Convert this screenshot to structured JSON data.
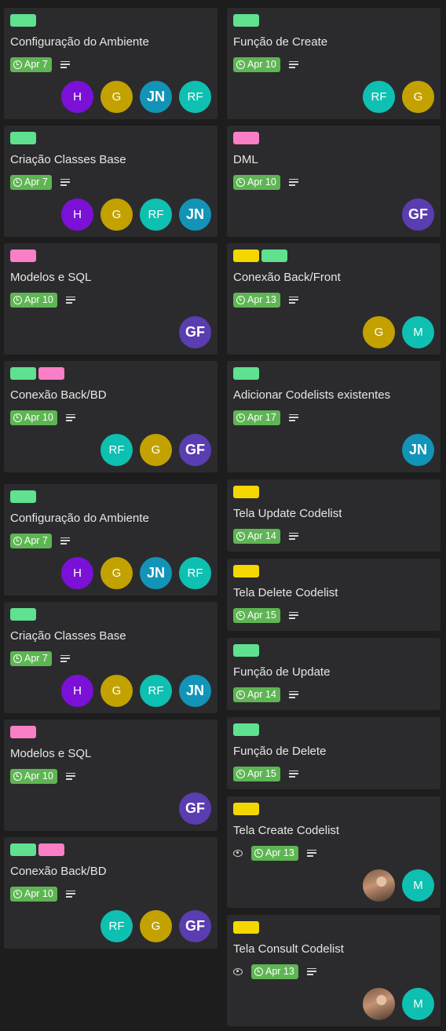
{
  "colors": {
    "green": "#5fe18f",
    "pink": "#fa7fc7",
    "yellow": "#f4d700",
    "due_badge": "#5eb553",
    "card_bg": "#2b2b2d",
    "board_bg": "#1d1d1e"
  },
  "members": {
    "H": {
      "initials": "H",
      "color": "#7b10d6"
    },
    "G": {
      "initials": "G",
      "color": "#c3a200"
    },
    "JN": {
      "initials": "JN",
      "color": "#1294b8"
    },
    "RF": {
      "initials": "RF",
      "color": "#0ec0b1"
    },
    "GF": {
      "initials": "GF",
      "color": "#5a3db0"
    },
    "M": {
      "initials": "M",
      "color": "#0ec0b1"
    }
  },
  "left_column": {
    "cards": [
      {
        "title": "Configuração do Ambiente",
        "labels": [
          "green"
        ],
        "due": "Apr 7",
        "has_description": true,
        "members": [
          "H",
          "G",
          "JN",
          "RF"
        ]
      },
      {
        "title": "Criação Classes Base",
        "labels": [
          "green"
        ],
        "due": "Apr 7",
        "has_description": true,
        "members": [
          "H",
          "G",
          "RF",
          "JN"
        ]
      },
      {
        "title": "Modelos e SQL",
        "labels": [
          "pink"
        ],
        "due": "Apr 10",
        "has_description": true,
        "members": [
          "GF"
        ]
      },
      {
        "title": "Conexão Back/BD",
        "labels": [
          "green",
          "pink"
        ],
        "due": "Apr 10",
        "has_description": true,
        "members": [
          "RF",
          "G",
          "GF"
        ]
      },
      {
        "title": "Configuração do Ambiente",
        "labels": [
          "green"
        ],
        "due": "Apr 7",
        "has_description": true,
        "members": [
          "H",
          "G",
          "JN",
          "RF"
        ]
      },
      {
        "title": "Criação Classes Base",
        "labels": [
          "green"
        ],
        "due": "Apr 7",
        "has_description": true,
        "members": [
          "H",
          "G",
          "RF",
          "JN"
        ]
      },
      {
        "title": "Modelos e SQL",
        "labels": [
          "pink"
        ],
        "due": "Apr 10",
        "has_description": true,
        "members": [
          "GF"
        ]
      },
      {
        "title": "Conexão Back/BD",
        "labels": [
          "green",
          "pink"
        ],
        "due": "Apr 10",
        "has_description": true,
        "members": [
          "RF",
          "G",
          "GF"
        ]
      }
    ]
  },
  "right_column": {
    "cards": [
      {
        "title": "Função de Create",
        "labels": [
          "green"
        ],
        "due": "Apr 10",
        "has_description": true,
        "members": [
          "RF",
          "G"
        ]
      },
      {
        "title": "DML",
        "labels": [
          "pink"
        ],
        "due": "Apr 10",
        "has_description": true,
        "members": [
          "GF"
        ]
      },
      {
        "title": "Conexão Back/Front",
        "labels": [
          "yellow",
          "green"
        ],
        "due": "Apr 13",
        "has_description": true,
        "members": [
          "G",
          "M"
        ]
      },
      {
        "title": "Adicionar Codelists existentes",
        "labels": [
          "green"
        ],
        "due": "Apr 17",
        "has_description": true,
        "members": [
          "JN"
        ]
      },
      {
        "title": "Tela Update Codelist",
        "labels": [
          "yellow"
        ],
        "due": "Apr 14",
        "has_description": true,
        "members": []
      },
      {
        "title": "Tela Delete Codelist",
        "labels": [
          "yellow"
        ],
        "due": "Apr 15",
        "has_description": true,
        "members": []
      },
      {
        "title": "Função de Update",
        "labels": [
          "green"
        ],
        "due": "Apr 14",
        "has_description": true,
        "members": []
      },
      {
        "title": "Função de Delete",
        "labels": [
          "green"
        ],
        "due": "Apr 15",
        "has_description": true,
        "members": []
      },
      {
        "title": "Tela Create Codelist",
        "labels": [
          "yellow"
        ],
        "watching": true,
        "due": "Apr 13",
        "has_description": true,
        "members": [
          "photo",
          "M"
        ]
      },
      {
        "title": "Tela Consult Codelist",
        "labels": [
          "yellow"
        ],
        "watching": true,
        "due": "Apr 13",
        "has_description": true,
        "members": [
          "photo",
          "M"
        ]
      }
    ]
  }
}
